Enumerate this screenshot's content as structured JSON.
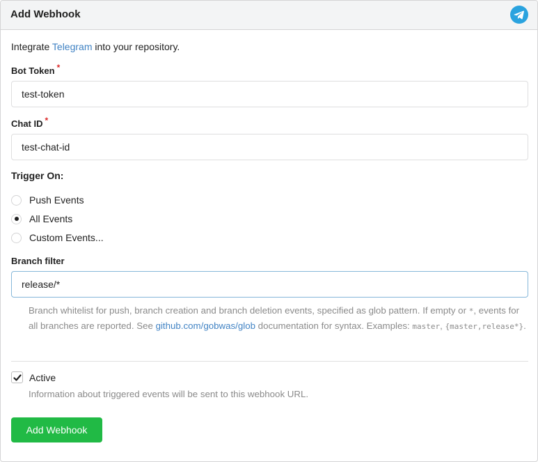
{
  "header": {
    "title": "Add Webhook",
    "icon": "telegram-icon",
    "icon_color": "#2aa3df"
  },
  "intro": {
    "prefix": "Integrate ",
    "link": "Telegram",
    "suffix": " into your repository."
  },
  "fields": {
    "bot_token": {
      "label": "Bot Token",
      "required_mark": "*",
      "value": "test-token"
    },
    "chat_id": {
      "label": "Chat ID",
      "required_mark": "*",
      "value": "test-chat-id"
    }
  },
  "trigger": {
    "title": "Trigger On:",
    "options": [
      {
        "label": "Push Events",
        "checked": false
      },
      {
        "label": "All Events",
        "checked": true
      },
      {
        "label": "Custom Events...",
        "checked": false
      }
    ]
  },
  "branch_filter": {
    "label": "Branch filter",
    "value": "release/*",
    "help_part1": "Branch whitelist for push, branch creation and branch deletion events, specified as glob pattern. If empty or ",
    "help_code1": "*",
    "help_part2": ", events for all branches are reported. See ",
    "help_link": "github.com/gobwas/glob",
    "help_part3": " documentation for syntax. Examples: ",
    "help_code2": "master",
    "help_part4": ", ",
    "help_code3": "{master,release*}",
    "help_part5": "."
  },
  "active": {
    "label": "Active",
    "checked": true,
    "help": "Information about triggered events will be sent to this webhook URL."
  },
  "submit": {
    "label": "Add Webhook",
    "color": "#21ba45"
  },
  "colors": {
    "link": "#4183c4",
    "required": "#db2828",
    "focus_border": "#85b7d9"
  }
}
